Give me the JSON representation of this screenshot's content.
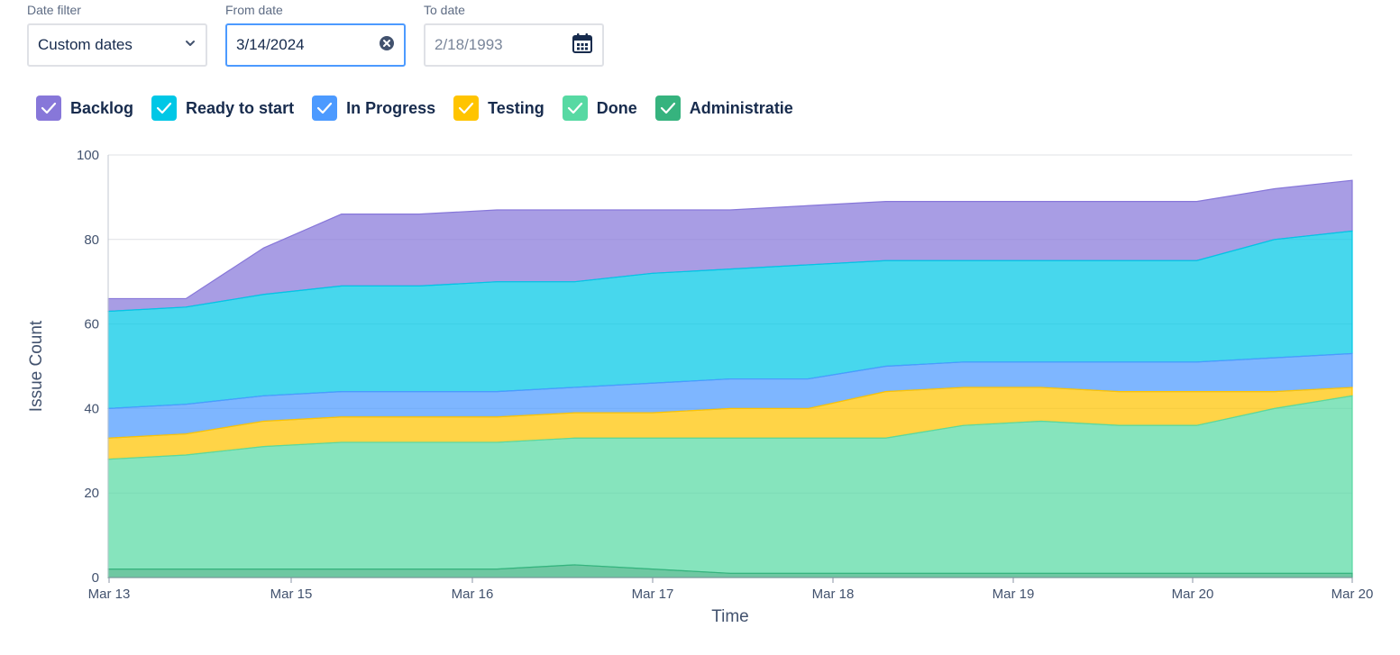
{
  "filters": {
    "date_filter": {
      "label": "Date filter",
      "value": "Custom dates"
    },
    "from_date": {
      "label": "From date",
      "value": "3/14/2024"
    },
    "to_date": {
      "label": "To date",
      "placeholder": "2/18/1993"
    }
  },
  "icons": {
    "dropdown": "chevron-down-icon",
    "clear": "clear-circle-icon",
    "calendar": "calendar-icon",
    "check": "checkmark-icon"
  },
  "legend": [
    {
      "label": "Backlog",
      "color": "#8777d9"
    },
    {
      "label": "Ready to start",
      "color": "#00c7e6"
    },
    {
      "label": "In Progress",
      "color": "#4c9aff"
    },
    {
      "label": "Testing",
      "color": "#ffc400"
    },
    {
      "label": "Done",
      "color": "#57d9a3"
    },
    {
      "label": "Administratie",
      "color": "#36b37e"
    }
  ],
  "chart_data": {
    "type": "area",
    "stacked": true,
    "xlabel": "Time",
    "ylabel": "Issue Count",
    "ylim": [
      0,
      100
    ],
    "y_ticks": [
      0,
      20,
      40,
      60,
      80,
      100
    ],
    "x_ticks": [
      "Mar 13",
      "Mar 15",
      "Mar 16",
      "Mar 17",
      "Mar 18",
      "Mar 19",
      "Mar 20",
      "Mar 20"
    ],
    "x": [
      "Mar 13 00:00",
      "Mar 13 12:00",
      "Mar 14 00:00",
      "Mar 14 12:00",
      "Mar 15 00:00",
      "Mar 15 12:00",
      "Mar 16 00:00",
      "Mar 16 12:00",
      "Mar 17 00:00",
      "Mar 17 12:00",
      "Mar 18 00:00",
      "Mar 18 12:00",
      "Mar 19 00:00",
      "Mar 19 12:00",
      "Mar 20 00:00",
      "Mar 20 12:00",
      "Mar 20 20:00"
    ],
    "cumulative_tops": [
      {
        "name": "Administratie",
        "values": [
          2,
          2,
          2,
          2,
          2,
          2,
          3,
          2,
          1,
          1,
          1,
          1,
          1,
          1,
          1,
          1,
          1
        ]
      },
      {
        "name": "Done",
        "values": [
          28,
          29,
          31,
          32,
          32,
          32,
          33,
          33,
          33,
          33,
          33,
          36,
          37,
          36,
          36,
          40,
          43
        ]
      },
      {
        "name": "Testing",
        "values": [
          33,
          34,
          37,
          38,
          38,
          38,
          39,
          39,
          40,
          40,
          44,
          45,
          45,
          44,
          44,
          44,
          45
        ]
      },
      {
        "name": "In Progress",
        "values": [
          40,
          41,
          43,
          44,
          44,
          44,
          45,
          46,
          47,
          47,
          50,
          51,
          51,
          51,
          51,
          52,
          53
        ]
      },
      {
        "name": "Ready to start",
        "values": [
          63,
          64,
          67,
          69,
          69,
          70,
          70,
          72,
          73,
          74,
          75,
          75,
          75,
          75,
          75,
          80,
          82
        ]
      },
      {
        "name": "Backlog",
        "values": [
          66,
          66,
          78,
          86,
          86,
          87,
          87,
          87,
          87,
          88,
          89,
          89,
          89,
          89,
          89,
          92,
          94
        ]
      }
    ]
  }
}
